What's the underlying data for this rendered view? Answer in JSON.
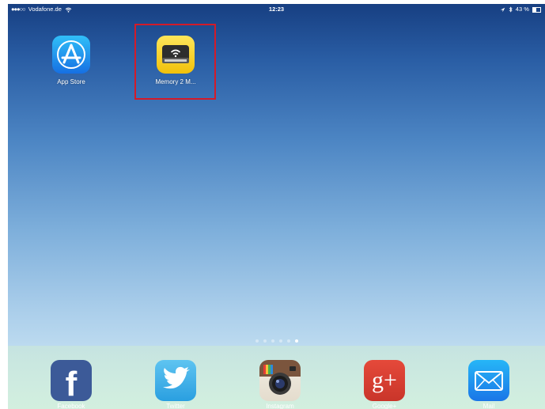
{
  "status_bar": {
    "signal_dots": "●●●○○",
    "carrier": "Vodafone.de",
    "time": "12:23",
    "battery": "43 %",
    "battery_level": 0.43
  },
  "home_apps": [
    {
      "label": "App Store",
      "icon": "app-store-icon"
    },
    {
      "label": "Memory 2 M...",
      "icon": "wifi-drive-icon"
    }
  ],
  "highlight_color": "#d31b29",
  "page_indicator": {
    "count": 6,
    "active_index": 5
  },
  "dock": [
    {
      "label": "Facebook",
      "icon": "facebook-icon"
    },
    {
      "label": "Twitter",
      "icon": "twitter-icon"
    },
    {
      "label": "Instagram",
      "icon": "instagram-icon"
    },
    {
      "label": "Google+",
      "icon": "google-plus-icon"
    },
    {
      "label": "Mail",
      "icon": "mail-icon"
    }
  ],
  "icon_glyphs": {
    "facebook": "f",
    "googleplus": "g+"
  }
}
